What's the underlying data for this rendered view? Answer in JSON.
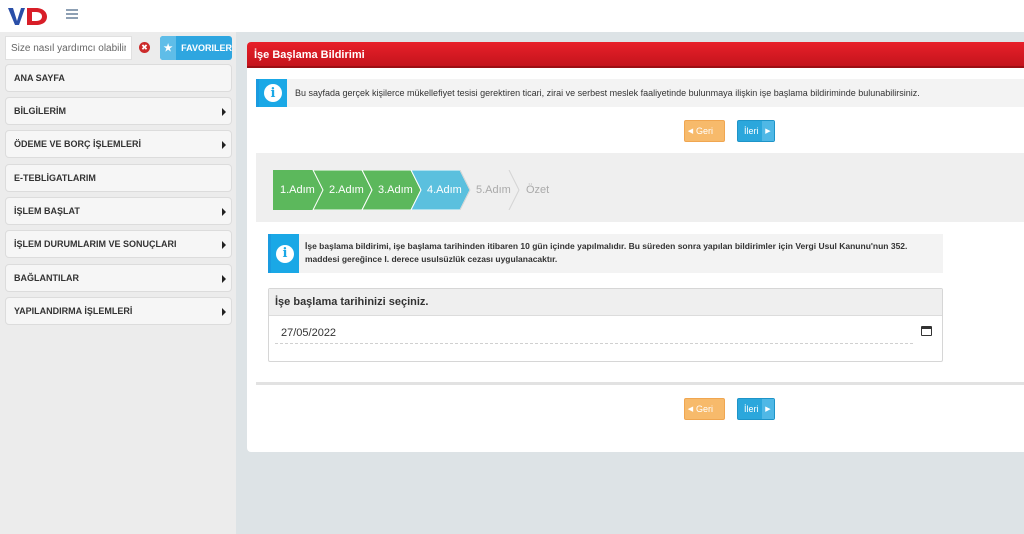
{
  "header": {
    "logo_icon": "vd-logo-icon",
    "menu_icon": "list-menu-icon"
  },
  "sidebar": {
    "search": {
      "placeholder": "Size nasıl yardımcı olabilirim?",
      "value": ""
    },
    "clear_label": "✖",
    "favorites_label": "FAVORILER",
    "items": [
      {
        "label": "ANA SAYFA",
        "has_caret": false
      },
      {
        "label": "BİLGİLERİM",
        "has_caret": true
      },
      {
        "label": "ÖDEME VE BORÇ İŞLEMLERİ",
        "has_caret": true
      },
      {
        "label": "E-TEBLİGATLARIM",
        "has_caret": false
      },
      {
        "label": "İŞLEM BAŞLAT",
        "has_caret": true
      },
      {
        "label": "İŞLEM DURUMLARIM VE SONUÇLARI",
        "has_caret": true
      },
      {
        "label": "BAĞLANTILAR",
        "has_caret": true
      },
      {
        "label": "YAPILANDIRMA İŞLEMLERİ",
        "has_caret": true
      }
    ]
  },
  "main": {
    "title": "İşe Başlama Bildirimi",
    "info_top": "Bu sayfada gerçek kişilerce mükellefiyet tesisi gerektiren ticari, zirai ve serbest meslek faaliyetinde bulunmaya ilişkin işe başlama bildiriminde bulunabilirsiniz.",
    "buttons": {
      "back": "Geri",
      "next": "İleri"
    },
    "steps": [
      {
        "label": "1.Adım",
        "state": "done",
        "color": "#5cb85c"
      },
      {
        "label": "2.Adım",
        "state": "done",
        "color": "#5cb85c"
      },
      {
        "label": "3.Adım",
        "state": "done",
        "color": "#5cb85c"
      },
      {
        "label": "4.Adım",
        "state": "active",
        "color": "#5bc0de"
      },
      {
        "label": "5.Adım",
        "state": "pending",
        "color": "#efefef"
      },
      {
        "label": "Özet",
        "state": "pending",
        "color": "#efefef"
      }
    ],
    "info_step": "İşe başlama bildirimi, işe başlama tarihinden itibaren 10 gün içinde yapılmalıdır. Bu süreden sonra yapılan bildirimler için Vergi Usul Kanunu'nun 352. maddesi gereğince I. derece usulsüzlük cezası uygulanacaktır.",
    "date_section": {
      "heading": "İşe başlama tarihinizi seçiniz.",
      "value": "27/05/2022",
      "icon": "calendar-icon"
    }
  }
}
